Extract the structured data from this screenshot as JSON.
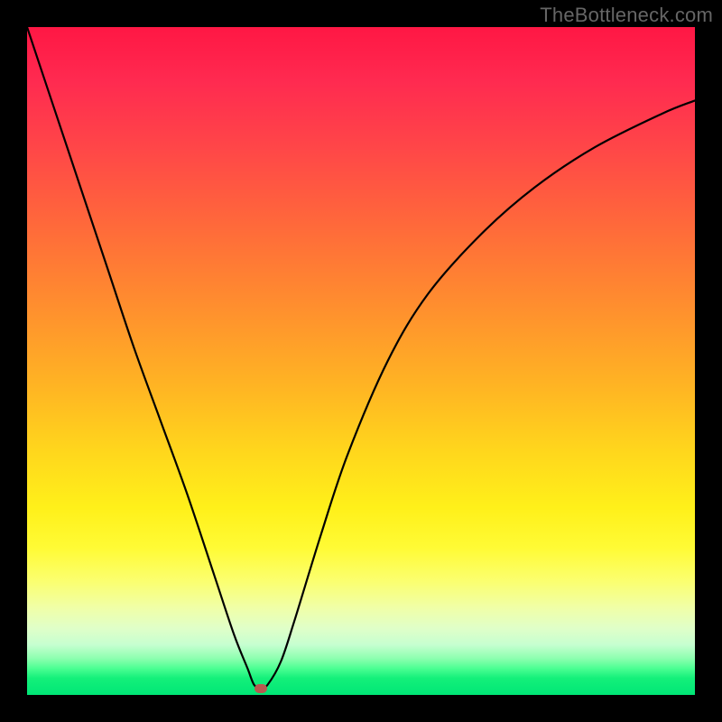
{
  "watermark": "TheBottleneck.com",
  "chart_data": {
    "type": "line",
    "title": "",
    "xlabel": "",
    "ylabel": "",
    "xlim": [
      0,
      100
    ],
    "ylim": [
      0,
      100
    ],
    "grid": false,
    "legend": false,
    "series": [
      {
        "name": "bottleneck-curve",
        "x": [
          0,
          4,
          8,
          12,
          16,
          20,
          24,
          28,
          31,
          33,
          34,
          35,
          36,
          38,
          40,
          44,
          48,
          54,
          60,
          68,
          76,
          85,
          95,
          100
        ],
        "y": [
          100,
          88,
          76,
          64,
          52,
          41,
          30,
          18,
          9,
          4,
          1.5,
          1,
          1.5,
          5,
          11,
          24,
          36,
          50,
          60,
          69,
          76,
          82,
          87,
          89
        ]
      }
    ],
    "marker": {
      "x": 35,
      "y": 1
    },
    "background_gradient": {
      "direction": "vertical",
      "stops": [
        {
          "pct": 0,
          "color": "#ff1744"
        },
        {
          "pct": 30,
          "color": "#ff6a3a"
        },
        {
          "pct": 64,
          "color": "#ffd81c"
        },
        {
          "pct": 83,
          "color": "#fbff70"
        },
        {
          "pct": 94.5,
          "color": "#8effb0"
        },
        {
          "pct": 100,
          "color": "#00e676"
        }
      ]
    }
  }
}
